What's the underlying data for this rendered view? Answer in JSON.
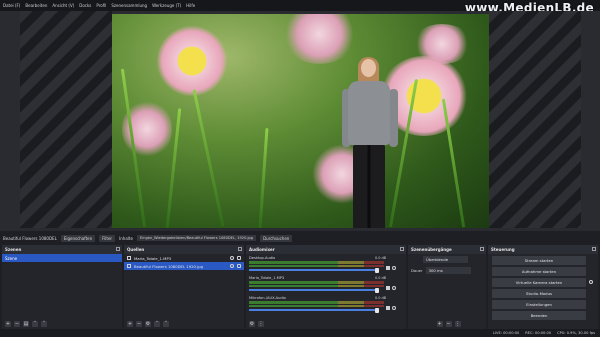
{
  "menu": [
    "Datei (F)",
    "Bearbeiten",
    "Ansicht (V)",
    "Docks",
    "Profil",
    "Szenensammlung",
    "Werkzeuge (T)",
    "Hilfe"
  ],
  "watermark": "www.MedienLB.de",
  "source_toolbar": {
    "selected_source": "Beautiful Flowers 1080DEL",
    "properties_button": "Eigenschaften",
    "filters_button": "Filter",
    "file_label": "Inhalte",
    "file_path": "Eingen_Wiedergabelisten/Beautiful Flowers 1080DEL, 1920.jpg",
    "browse_button": "Durchsuchen"
  },
  "scenes_dock": {
    "title": "Szenen",
    "items": [
      "Szene"
    ],
    "selected": 0
  },
  "sources_dock": {
    "title": "Quellen",
    "items": [
      "Maria_Totale_1.MP3",
      "Beautiful Flowers 1080DEL 1920.jpg"
    ],
    "selected": 1
  },
  "mixer_dock": {
    "title": "Audiomixer",
    "channels": [
      {
        "name": "Desktop-Audio",
        "db": "0.0 dB"
      },
      {
        "name": "Maria_Totale_1.MP3",
        "db": "0.0 dB"
      },
      {
        "name": "Mikrofon-/AUX-Audio",
        "db": "0.0 dB"
      }
    ]
  },
  "transitions_dock": {
    "title": "Szenenübergänge",
    "type": "Überblende",
    "duration_label": "Dauer",
    "duration": "300 ms"
  },
  "controls_dock": {
    "title": "Steuerung",
    "buttons": [
      "Stream starten",
      "Aufnahme starten",
      "Virtuelle Kamera starten",
      "Studio-Modus",
      "Einstellungen",
      "Beenden"
    ]
  },
  "status": {
    "live": "LIVE: 00:00:00",
    "rec": "REC: 00:00:00",
    "cpu": "CPU: 0.9%, 30.00 fps"
  },
  "colors": {
    "accent": "#2b59c3",
    "background": "#1e1f24",
    "dock": "#23252b"
  }
}
